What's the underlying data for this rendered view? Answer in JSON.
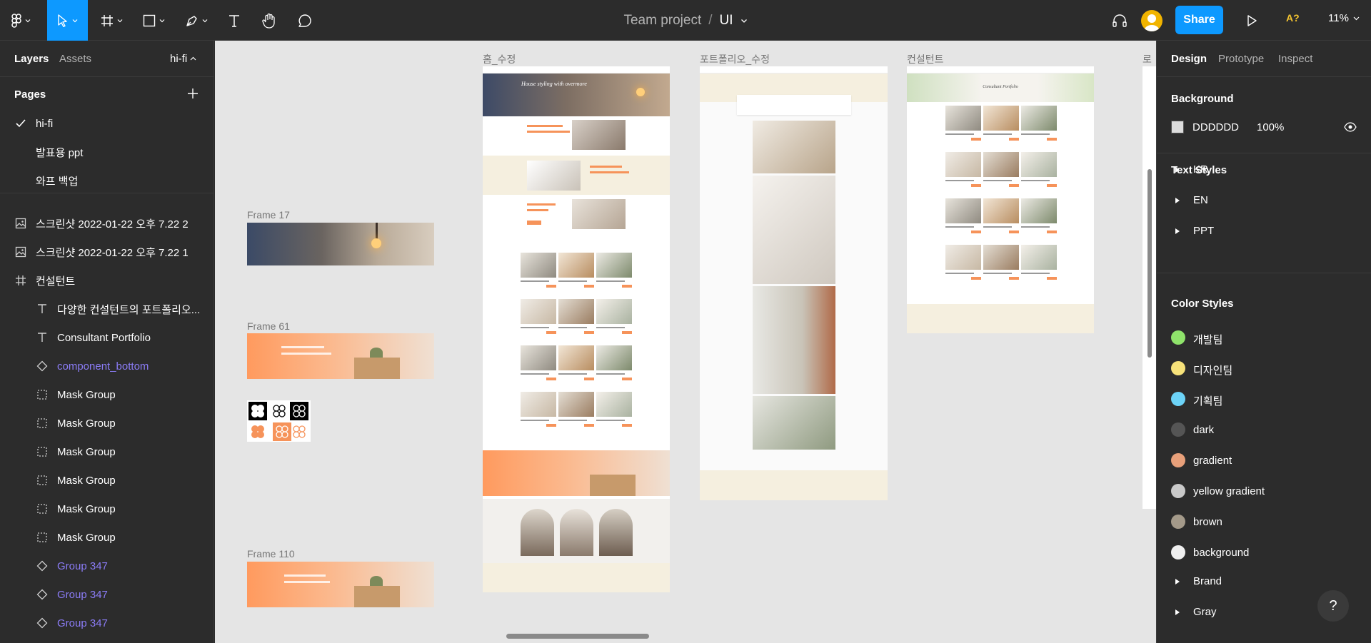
{
  "project": {
    "team": "Team project",
    "separator": "/",
    "file": "UI"
  },
  "toolbar": {
    "share_label": "Share",
    "zoom_label": "11%",
    "font_warning": "A?"
  },
  "left_panel": {
    "tabs": {
      "layers": "Layers",
      "assets": "Assets",
      "page_selector": "hi-fi"
    },
    "pages_heading": "Pages",
    "pages": [
      {
        "label": "hi-fi",
        "selected": true
      },
      {
        "label": "발표용 ppt",
        "selected": false
      },
      {
        "label": "와프 백업",
        "selected": false
      }
    ],
    "layers": [
      {
        "label": "스크린샷 2022-01-22 오후 7.22 2",
        "icon": "image-icon",
        "child": false,
        "component": false
      },
      {
        "label": "스크린샷 2022-01-22 오후 7.22 1",
        "icon": "image-icon",
        "child": false,
        "component": false
      },
      {
        "label": "컨설턴트",
        "icon": "frame-icon",
        "child": false,
        "component": false
      },
      {
        "label": "다양한 컨설턴트의 포트폴리오...",
        "icon": "text-icon",
        "child": true,
        "component": false
      },
      {
        "label": "Consultant Portfolio",
        "icon": "text-icon",
        "child": true,
        "component": false
      },
      {
        "label": "component_bottom",
        "icon": "component-icon",
        "child": true,
        "component": true
      },
      {
        "label": "Mask Group",
        "icon": "group-icon",
        "child": true,
        "component": false
      },
      {
        "label": "Mask Group",
        "icon": "group-icon",
        "child": true,
        "component": false
      },
      {
        "label": "Mask Group",
        "icon": "group-icon",
        "child": true,
        "component": false
      },
      {
        "label": "Mask Group",
        "icon": "group-icon",
        "child": true,
        "component": false
      },
      {
        "label": "Mask Group",
        "icon": "group-icon",
        "child": true,
        "component": false
      },
      {
        "label": "Mask Group",
        "icon": "group-icon",
        "child": true,
        "component": false
      },
      {
        "label": "Group 347",
        "icon": "component-icon",
        "child": true,
        "component": true
      },
      {
        "label": "Group 347",
        "icon": "component-icon",
        "child": true,
        "component": true
      },
      {
        "label": "Group 347",
        "icon": "component-icon",
        "child": true,
        "component": true
      }
    ]
  },
  "canvas": {
    "background": "#E5E5E5",
    "frame_labels": [
      "Frame 17",
      "Frame 61",
      "Frame 110",
      "홈_수정",
      "포트폴리오_수정",
      "컨설턴트",
      "로그"
    ],
    "hero_caption": "House styling with overmore",
    "consultant_caption": "Consultant Portfolio"
  },
  "right_panel": {
    "tabs": {
      "design": "Design",
      "prototype": "Prototype",
      "inspect": "Inspect"
    },
    "background_heading": "Background",
    "background_hex": "DDDDDD",
    "background_opacity": "100%",
    "text_styles_heading": "Text Styles",
    "text_styles": [
      "KR",
      "EN",
      "PPT"
    ],
    "color_styles_heading": "Color Styles",
    "color_styles": [
      {
        "name": "개발팀",
        "color": "#8fe36b"
      },
      {
        "name": "디자인팀",
        "color": "#f7e27a"
      },
      {
        "name": "기획팀",
        "color": "#6cd3f7"
      },
      {
        "name": "dark",
        "color": "#555555"
      },
      {
        "name": "gradient",
        "color": "#e8a07a"
      },
      {
        "name": "yellow gradient",
        "color": "#c9c9c9"
      },
      {
        "name": "brown",
        "color": "#a49a8a"
      },
      {
        "name": "background",
        "color": "#f0f0f0"
      }
    ],
    "style_groups": [
      "Brand",
      "Gray"
    ]
  },
  "help_label": "?"
}
